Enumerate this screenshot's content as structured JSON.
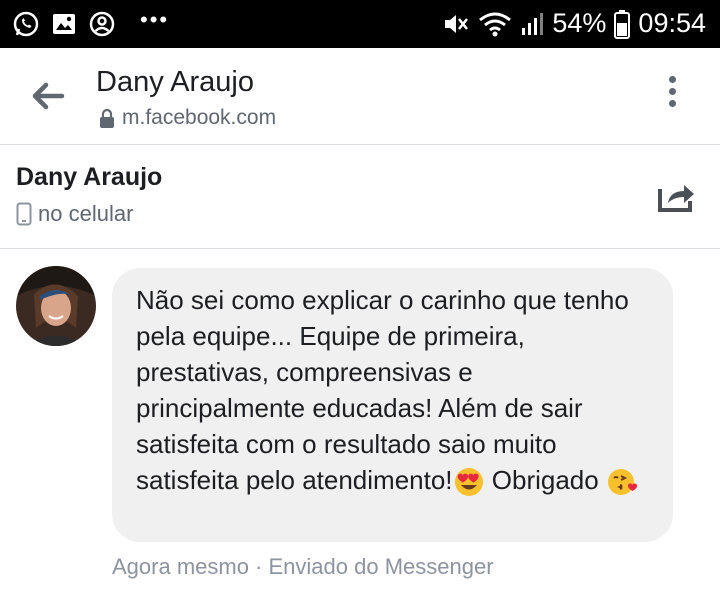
{
  "status_bar": {
    "battery": "54%",
    "time": "09:54",
    "icons": [
      "whatsapp-icon",
      "gallery-icon",
      "at-icon",
      "mute-icon",
      "wifi-icon",
      "signal-icon",
      "battery-icon"
    ]
  },
  "browser": {
    "title": "Dany Araujo",
    "url": "m.facebook.com"
  },
  "conversation": {
    "name": "Dany Araujo",
    "subtitle": "no celular"
  },
  "message": {
    "text": "Não sei como explicar o carinho que tenho pela equipe... Equipe de primeira, prestativas, compreensivas e principalmente educadas! Além de sair satisfeita com o resultado saio muito satisfeita pelo atendimento!",
    "text_after": " Obrigado",
    "emoji_1": "heart-eyes-emoji",
    "emoji_2": "kissing-heart-emoji",
    "meta": "Agora mesmo · Enviado do Messenger"
  }
}
